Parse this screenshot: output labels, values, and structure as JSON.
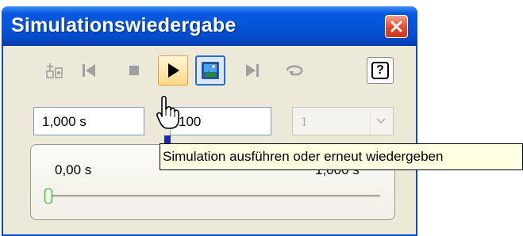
{
  "window": {
    "title": "Simulationswiedergabe",
    "close_label": "✕"
  },
  "toolbar": {
    "buttons": [
      {
        "name": "construct-mode",
        "icon": "construct-mode-icon"
      },
      {
        "name": "rewind",
        "icon": "skip-back-icon"
      },
      {
        "name": "stop",
        "icon": "stop-icon"
      },
      {
        "name": "play",
        "icon": "play-icon"
      },
      {
        "name": "screen-refresh",
        "icon": "screen-refresh-icon"
      },
      {
        "name": "end",
        "icon": "skip-forward-icon"
      },
      {
        "name": "replay-mode",
        "icon": "replay-loop-icon"
      }
    ],
    "help_label": "?"
  },
  "fields": {
    "end_time": "1,000 s",
    "images": "100",
    "filter_value": "1"
  },
  "panel": {
    "current_time": "0,00 s",
    "end_time_display": "1,000 s",
    "progress": 0.0
  },
  "tooltip": {
    "text": "Simulation ausführen oder erneut wiedergeben"
  },
  "colors": {
    "titlebar": "#0454d8",
    "window_bg": "#ece9d8",
    "close_button": "#e0492a",
    "tooltip_bg": "#ffffe1",
    "slider_thumb": "#3a9a2a"
  }
}
